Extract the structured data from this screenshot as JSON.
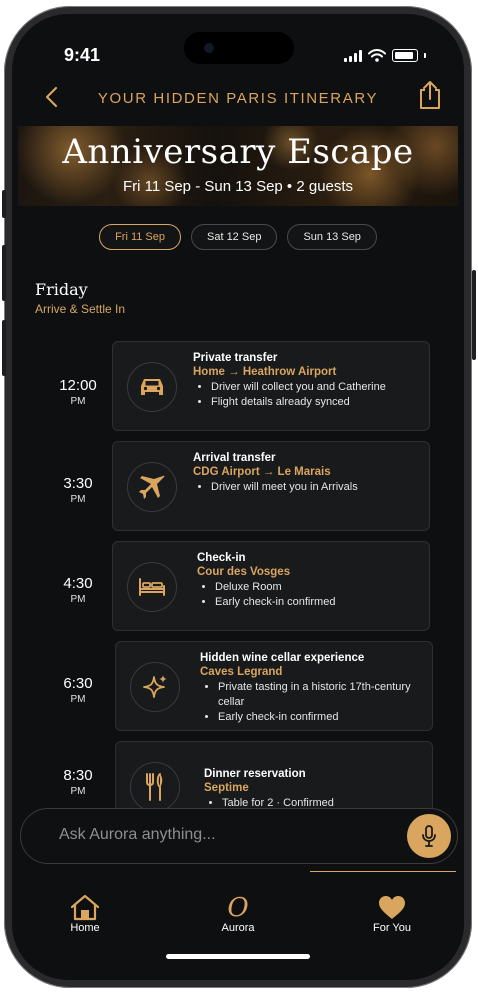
{
  "status_bar": {
    "time": "9:41"
  },
  "header": {
    "title": "YOUR HIDDEN PARIS ITINERARY"
  },
  "hero": {
    "title": "Anniversary Escape",
    "subtitle": "Fri 11 Sep - Sun 13 Sep  •  2 guests"
  },
  "day_tabs": [
    {
      "label": "Fri 11 Sep",
      "active": true
    },
    {
      "label": "Sat 12 Sep",
      "active": false
    },
    {
      "label": "Sun 13 Sep",
      "active": false
    }
  ],
  "day": {
    "heading": "Friday",
    "subtitle": "Arrive & Settle In"
  },
  "events": [
    {
      "time": "12:00",
      "period": "PM",
      "icon": "car-icon",
      "title": "Private transfer",
      "subtitle": "Home → Heathrow Airport",
      "details": [
        "Driver will collect you and Catherine",
        "Flight details already synced"
      ]
    },
    {
      "time": "3:30",
      "period": "PM",
      "icon": "plane-icon",
      "title": "Arrival transfer",
      "subtitle": "CDG Airport → Le Marais",
      "details": [
        "Driver will meet you in Arrivals"
      ]
    },
    {
      "time": "4:30",
      "period": "PM",
      "icon": "bed-icon",
      "title": "Check-in",
      "subtitle": "Cour des Vosges",
      "details": [
        "Deluxe Room",
        "Early check-in confirmed"
      ]
    },
    {
      "time": "6:30",
      "period": "PM",
      "icon": "sparkle-icon",
      "title": "Hidden wine cellar experience",
      "subtitle": "Caves Legrand",
      "details": [
        "Private tasting in a historic 17th-century cellar",
        "Early check-in confirmed"
      ]
    },
    {
      "time": "8:30",
      "period": "PM",
      "icon": "cutlery-icon",
      "title": "Dinner reservation",
      "subtitle": "Septime",
      "details": [
        "Table for 2 · Confirmed"
      ]
    }
  ],
  "chat": {
    "placeholder": "Ask Aurora anything..."
  },
  "tabbar": {
    "home_label": "Home",
    "aurora_label": "Aurora",
    "aurora_glyph": "O",
    "foryou_label": "For You"
  },
  "colors": {
    "accent": "#d9a55f",
    "background": "#0e0f10",
    "card": "#181a1b"
  }
}
